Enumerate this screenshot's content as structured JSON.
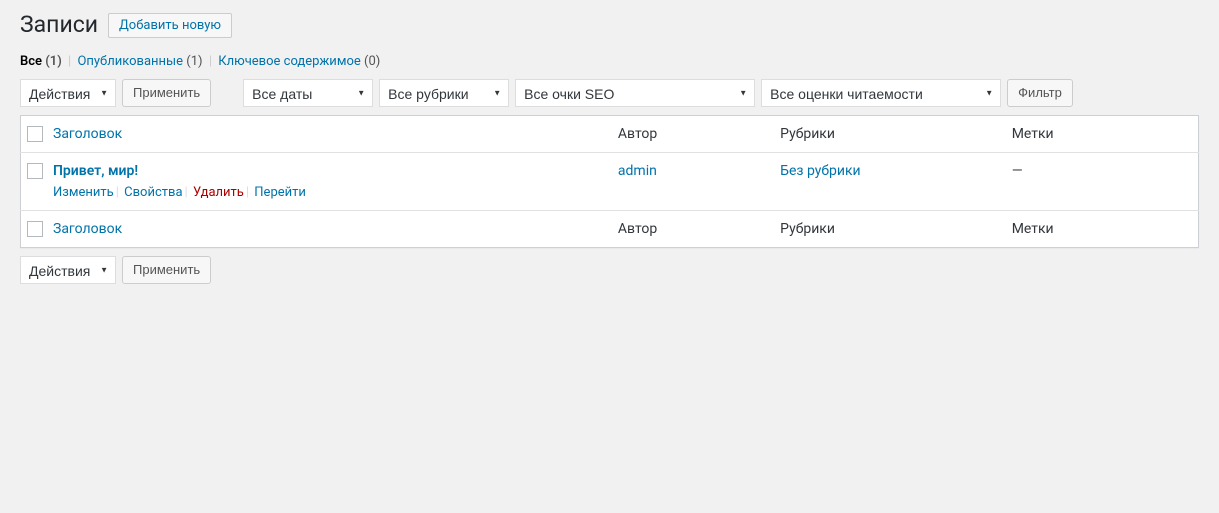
{
  "header": {
    "title": "Записи",
    "add_new": "Добавить новую"
  },
  "filters_status": {
    "all_label": "Все",
    "all_count": "(1)",
    "published_label": "Опубликованные",
    "published_count": "(1)",
    "cornerstone_label": "Ключевое содержимое",
    "cornerstone_count": "(0)"
  },
  "bulk": {
    "actions_label": "Действия",
    "apply_label": "Применить"
  },
  "filters": {
    "dates": "Все даты",
    "categories": "Все рубрики",
    "seo": "Все очки SEO",
    "readability": "Все оценки читаемости",
    "filter_button": "Фильтр"
  },
  "columns": {
    "title": "Заголовок",
    "author": "Автор",
    "categories": "Рубрики",
    "tags": "Метки"
  },
  "rows": [
    {
      "title": "Привет, мир!",
      "author": "admin",
      "category": "Без рубрики",
      "tags": "—",
      "actions": {
        "edit": "Изменить",
        "quick": "Свойства",
        "trash": "Удалить",
        "view": "Перейти"
      }
    }
  ]
}
